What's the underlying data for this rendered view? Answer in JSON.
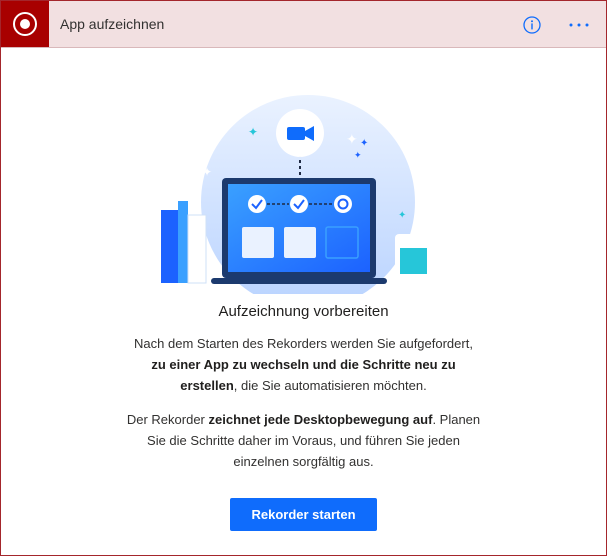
{
  "header": {
    "title": "App aufzeichnen",
    "icons": {
      "record": "record-icon",
      "info": "info-icon",
      "more": "more-icon"
    }
  },
  "main": {
    "heading": "Aufzeichnung vorbereiten",
    "paragraph1": {
      "line1": "Nach dem Starten des Rekorders werden Sie aufgefordert,",
      "line2_bold": "zu einer App zu wechseln und die Schritte neu zu",
      "line3_bold": "erstellen",
      "line3_rest": ", die Sie automatisieren möchten."
    },
    "paragraph2": {
      "line1_start": "Der Rekorder ",
      "line1_bold": "zeichnet jede Desktopbewegung auf",
      "line1_end": ". Planen",
      "line2": "Sie die Schritte daher im Voraus, und führen Sie jeden",
      "line3": "einzelnen sorgfältig aus."
    },
    "start_button": "Rekorder starten"
  },
  "colors": {
    "accent": "#0f6cfc",
    "record": "#a80000",
    "header_bg": "#f2e0e1"
  }
}
